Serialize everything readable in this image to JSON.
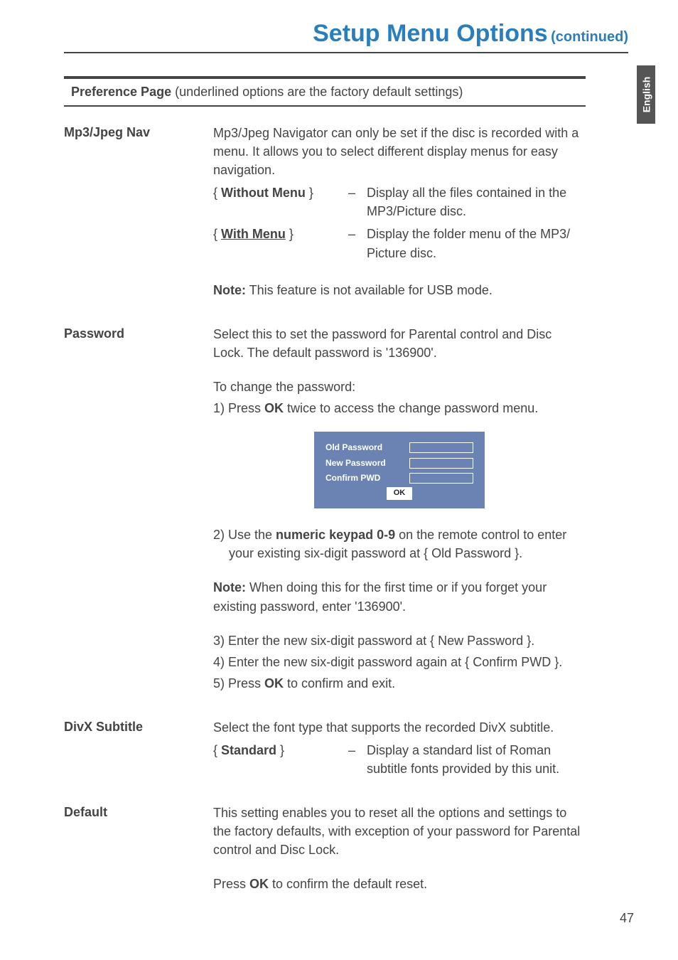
{
  "header": {
    "title_main": "Setup Menu Options",
    "title_sub": "(continued)"
  },
  "side_tab": "English",
  "section_bar": {
    "strong": "Preference Page",
    "rest": " (underlined options are the factory default settings)"
  },
  "rows": {
    "mp3": {
      "label": "Mp3/Jpeg Nav",
      "intro": "Mp3/Jpeg Navigator can only be set if the disc is recorded with a menu. It allows you to select different display menus for easy navigation.",
      "opts": [
        {
          "name": "Without Menu",
          "desc": "Display all the files contained in the MP3/Picture disc.",
          "default": false
        },
        {
          "name": "With Menu",
          "desc": "Display the folder menu of the MP3/ Picture disc.",
          "default": true
        }
      ],
      "note_label": "Note:",
      "note_text": "  This feature is not available for USB mode."
    },
    "password": {
      "label": "Password",
      "intro": "Select this to set the password for Parental control and Disc Lock. The default password is '136900'.",
      "change_label": "To change the password:",
      "step1_pre": "1)  Press ",
      "step1_bold": "OK",
      "step1_post": " twice to access the change password menu.",
      "dialog": {
        "old": "Old  Password",
        "new": "New Password",
        "confirm": "Confirm PWD",
        "ok": "OK"
      },
      "step2_pre": "2)  Use the ",
      "step2_bold": "numeric keypad 0-9",
      "step2_post": " on the remote control to enter your existing six-digit password at { Old Password }.",
      "note_label": "Note:",
      "note_text": "  When doing this for the first time or if you forget your existing password, enter '136900'.",
      "step3": "3)  Enter the new six-digit password at { New Password }.",
      "step4": "4)  Enter the new six-digit password again at { Confirm PWD }.",
      "step5_pre": "5)  Press ",
      "step5_bold": "OK",
      "step5_post": " to confirm and exit."
    },
    "divx": {
      "label": "DivX Subtitle",
      "intro": "Select the font type that supports the recorded DivX subtitle.",
      "opts": [
        {
          "name": "Standard",
          "desc": "Display a standard list of Roman subtitle fonts provided by this unit.",
          "default": false
        }
      ]
    },
    "default": {
      "label": "Default",
      "intro": "This setting enables you to reset all the options and settings to the factory defaults, with exception of your password for Parental control and Disc Lock.",
      "press_pre": "Press ",
      "press_bold": "OK",
      "press_post": " to confirm the default reset."
    }
  },
  "page_number": "47"
}
